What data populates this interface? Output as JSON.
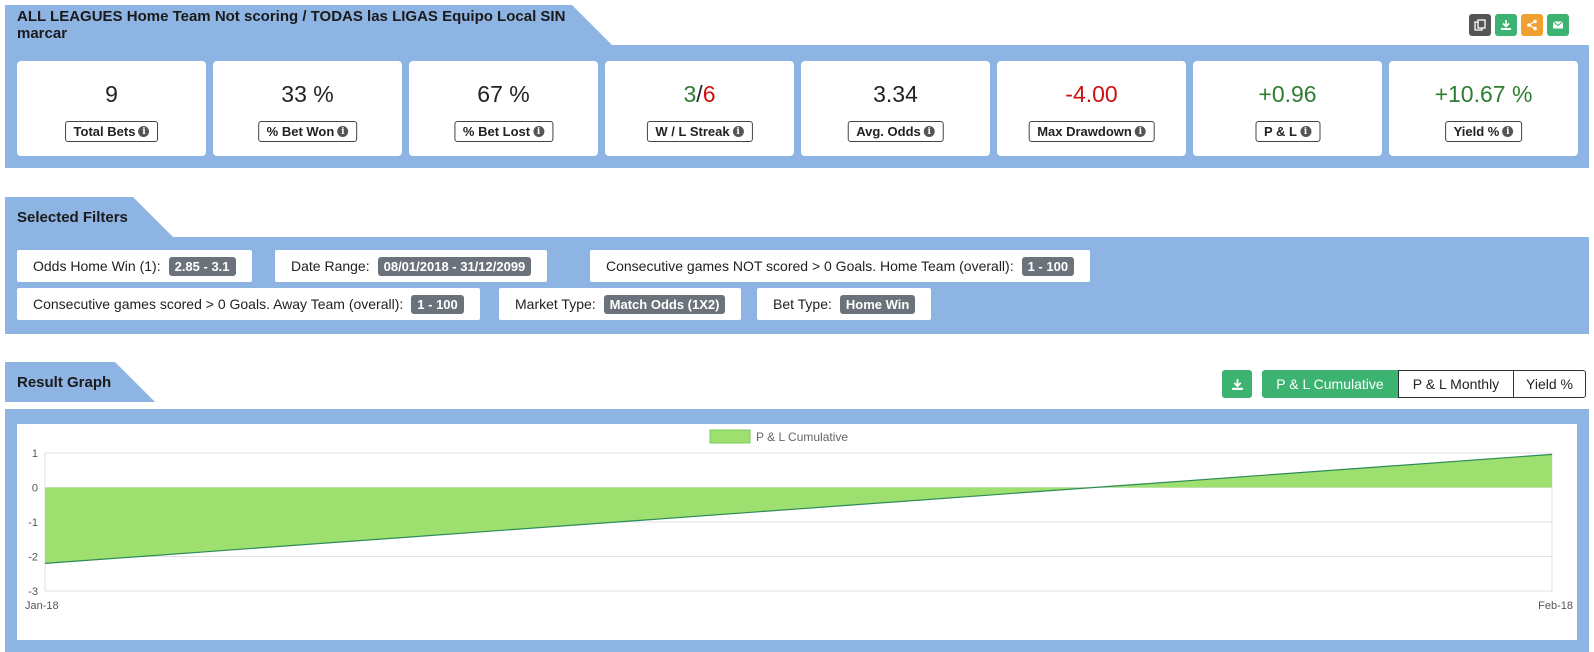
{
  "header": {
    "title": "ALL LEAGUES Home Team Not scoring / TODAS las LIGAS Equipo Local SIN marcar",
    "actions": [
      {
        "icon": "copy-icon",
        "color": "#555555"
      },
      {
        "icon": "download-icon",
        "color": "#3cb371"
      },
      {
        "icon": "share-icon",
        "color": "#f0a030"
      },
      {
        "icon": "email-icon",
        "color": "#3cb371"
      }
    ]
  },
  "stats": [
    {
      "value": "9",
      "label": "Total Bets",
      "color": "#222222"
    },
    {
      "value": "33 %",
      "label": "% Bet Won",
      "color": "#222222"
    },
    {
      "value": "67 %",
      "label": "% Bet Lost",
      "color": "#222222"
    },
    {
      "value_win": "3",
      "value_sep": "/",
      "value_loss": "6",
      "label": "W / L Streak"
    },
    {
      "value": "3.34",
      "label": "Avg. Odds",
      "color": "#222222"
    },
    {
      "value": "-4.00",
      "label": "Max Drawdown",
      "color": "#cc1111"
    },
    {
      "value": "+0.96",
      "label": "P & L",
      "color": "#2e7d32"
    },
    {
      "value": "+10.67 %",
      "label": "Yield %",
      "color": "#2e7d32"
    }
  ],
  "filters": {
    "title": "Selected Filters",
    "items": [
      {
        "label": "Odds Home Win (1):",
        "value": "2.85 - 3.1"
      },
      {
        "label": "Date Range:",
        "value": "08/01/2018 - 31/12/2099"
      },
      {
        "label": "Consecutive games NOT scored > 0 Goals. Home Team (overall):",
        "value": "1 - 100"
      },
      {
        "label": "Consecutive games scored > 0 Goals. Away Team (overall):",
        "value": "1 - 100"
      },
      {
        "label": "Market Type:",
        "value": "Match Odds (1X2)"
      },
      {
        "label": "Bet Type:",
        "value": "Home Win"
      }
    ]
  },
  "graph": {
    "title": "Result Graph",
    "tabs": [
      "P & L Cumulative",
      "P & L Monthly",
      "Yield %"
    ],
    "active_tab": "P & L Cumulative"
  },
  "chart_data": {
    "type": "area",
    "x": [
      "Jan-18",
      "Feb-18"
    ],
    "series": [
      {
        "name": "P & L Cumulative",
        "values": [
          -2.2,
          0.96
        ],
        "fill": "#9de070",
        "line": "#2e8b57"
      }
    ],
    "yticks": [
      1,
      0,
      -1,
      -2,
      -3
    ],
    "ylim": [
      -3,
      1
    ],
    "legend": "top",
    "grid": true
  }
}
